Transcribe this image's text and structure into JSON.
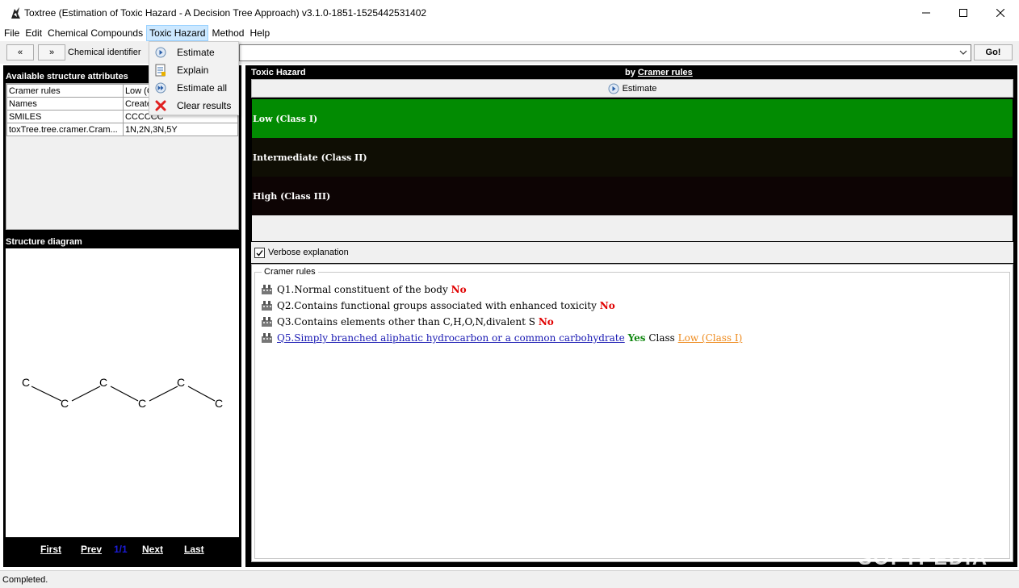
{
  "window": {
    "title": "Toxtree (Estimation of Toxic Hazard - A Decision Tree Approach) v3.1.0-1851-1525442531402"
  },
  "menu": [
    "File",
    "Edit",
    "Chemical Compounds",
    "Toxic Hazard",
    "Method",
    "Help"
  ],
  "dropdown": {
    "items": [
      "Estimate",
      "Explain",
      "Estimate all",
      "Clear results"
    ]
  },
  "toolbar": {
    "prev_label": "«",
    "next_label": "»",
    "identifier_label": "Chemical identifier",
    "identifier_value": "",
    "go_label": "Go!"
  },
  "left": {
    "attributes_header": "Available structure attributes",
    "attributes": [
      {
        "key": "Cramer rules",
        "value": "Low (C"
      },
      {
        "key": "Names",
        "value": "Create"
      },
      {
        "key": "SMILES",
        "value": "CCCCCC"
      },
      {
        "key": "toxTree.tree.cramer.Cram...",
        "value": "1N,2N,3N,5Y"
      }
    ],
    "structure_header": "Structure diagram",
    "atoms": [
      "C",
      "C",
      "C",
      "C",
      "C",
      "C"
    ],
    "pager": {
      "first": "First",
      "prev": "Prev",
      "current": "1/1",
      "next": "Next",
      "last": "Last"
    }
  },
  "right": {
    "title": "Toxic Hazard",
    "by_label": "by",
    "method_link": "Cramer rules",
    "estimate_label": "Estimate",
    "classes": [
      {
        "label": "Low (Class I)",
        "color": "#028b02"
      },
      {
        "label": "Intermediate (Class II)",
        "color": "#0f0e04"
      },
      {
        "label": "High (Class III)",
        "color": "#0d0404"
      }
    ],
    "verbose_label": "Verbose explanation",
    "verbose_checked": true,
    "explanation_legend": "Cramer rules",
    "rules": [
      {
        "question": "Q1.Normal constituent of the body",
        "answer": "No"
      },
      {
        "question": "Q2.Contains functional groups associated with enhanced toxicity",
        "answer": "No"
      },
      {
        "question": "Q3.Contains elements other than C,H,O,N,divalent S",
        "answer": "No"
      },
      {
        "question": "Q5.Simply branched aliphatic hydrocarbon or a common carbohydrate",
        "answer": "Yes",
        "class_label": "Class",
        "result": "Low (Class I)"
      }
    ]
  },
  "status": {
    "text": "Completed."
  },
  "watermark": "SOFTPEDIA"
}
